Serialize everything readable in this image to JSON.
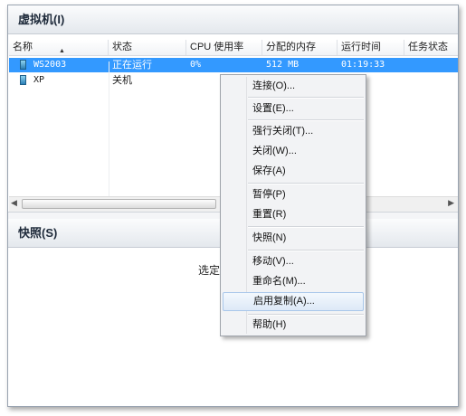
{
  "vm_panel": {
    "title": "虚拟机(I)"
  },
  "columns": [
    "名称",
    "状态",
    "CPU 使用率",
    "分配的内存",
    "运行时间",
    "任务状态"
  ],
  "vms": [
    {
      "name": "WS2003",
      "status": "正在运行",
      "cpu": "0%",
      "memory": "512 MB",
      "uptime": "01:19:33",
      "selected": true
    },
    {
      "name": "XP",
      "status": "关机",
      "cpu": "",
      "memory": "",
      "uptime": "",
      "selected": false
    }
  ],
  "snapshot_panel": {
    "title": "快照(S)",
    "hint": "选定"
  },
  "context_menu": {
    "items": [
      {
        "label": "连接(O)..."
      },
      {
        "label": "设置(E)..."
      },
      {
        "label": "强行关闭(T)..."
      },
      {
        "label": "关闭(W)..."
      },
      {
        "label": "保存(A)"
      },
      {
        "label": "暂停(P)"
      },
      {
        "label": "重置(R)"
      },
      {
        "label": "快照(N)"
      },
      {
        "label": "移动(V)..."
      },
      {
        "label": "重命名(M)..."
      },
      {
        "label": "启用复制(A)...",
        "highlighted": true
      },
      {
        "label": "帮助(H)"
      }
    ]
  },
  "colors": {
    "selection": "#3399ff",
    "menu_highlight": "#dde9f7"
  }
}
